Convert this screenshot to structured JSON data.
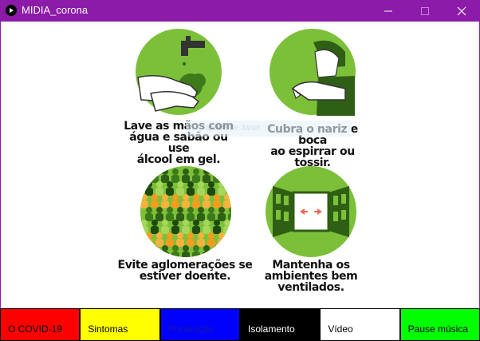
{
  "window": {
    "title": "MIDIA_corona",
    "controls": {
      "minimize": "minimize-icon",
      "maximize": "maximize-icon",
      "close": "close-icon"
    }
  },
  "watermark": {
    "text": "aptura de Janel"
  },
  "panels": [
    {
      "id": "wash-hands",
      "icon": "hand-washing-icon",
      "lines": [
        "Lave as mãos com",
        "água e sabão ou use",
        "álcool em gel."
      ]
    },
    {
      "id": "cover-nose",
      "icon": "cough-elbow-icon",
      "lines": [
        "Cubra o nariz e boca",
        "ao espirrar ou tossir."
      ]
    },
    {
      "id": "avoid-crowds",
      "icon": "crowd-icon",
      "lines": [
        "Evite aglomerações se",
        "estiver doente."
      ]
    },
    {
      "id": "ventilation",
      "icon": "open-window-icon",
      "lines": [
        "Mantenha os",
        "ambientes bem",
        "ventilados."
      ]
    }
  ],
  "tabs": [
    {
      "label": "O COVID-19",
      "bg": "#ff0000",
      "fg": "#000000"
    },
    {
      "label": "Sintomas",
      "bg": "#ffff00",
      "fg": "#000000"
    },
    {
      "label": "Prevenção",
      "bg": "#0000ff",
      "fg": "#1a1aa0"
    },
    {
      "label": "Isolamento",
      "bg": "#000000",
      "fg": "#ffffff"
    },
    {
      "label": "Vídeo",
      "bg": "#ffffff",
      "fg": "#000000"
    },
    {
      "label": "Pause música",
      "bg": "#00ff00",
      "fg": "#000000"
    }
  ],
  "colors": {
    "titlebar": "#8b1ba8",
    "circle": "#7cc03a",
    "dark_green": "#2f5f14"
  }
}
